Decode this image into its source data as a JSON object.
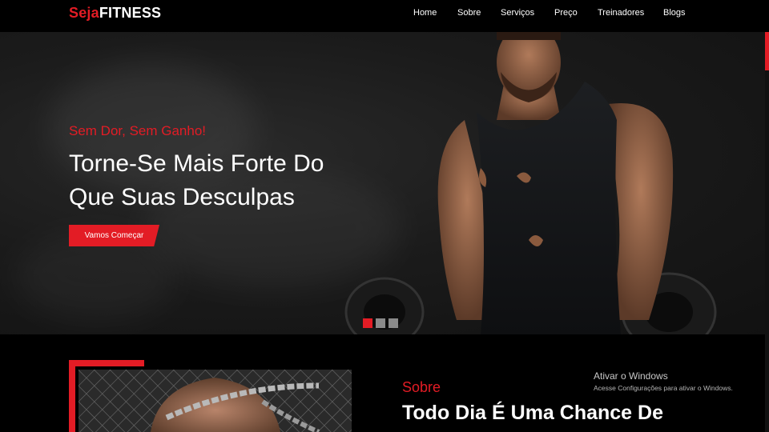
{
  "brand": {
    "accent": "Seja",
    "main": "FITNESS"
  },
  "nav": [
    {
      "label": "Home"
    },
    {
      "label": "Sobre"
    },
    {
      "label": "Serviços"
    },
    {
      "label": "Preço"
    },
    {
      "label": "Treinadores"
    },
    {
      "label": "Blogs"
    }
  ],
  "hero": {
    "subtitle": "Sem Dor, Sem Ganho!",
    "title": "Torne-Se Mais Forte Do Que Suas Desculpas",
    "button": "Vamos Começar",
    "slides": {
      "count": 3,
      "active": 1
    }
  },
  "about": {
    "label": "Sobre",
    "title": "Todo Dia É Uma Chance De"
  },
  "windows_watermark": {
    "title": "Ativar o Windows",
    "subtitle": "Acesse Configurações para ativar o Windows."
  },
  "colors": {
    "accent": "#e31c25",
    "background": "#000000",
    "hero_bg": "#1b1b1b"
  },
  "icons": [
    "slide-indicator",
    "hero-photo-man-with-barbell",
    "about-photo-man-with-chains"
  ]
}
